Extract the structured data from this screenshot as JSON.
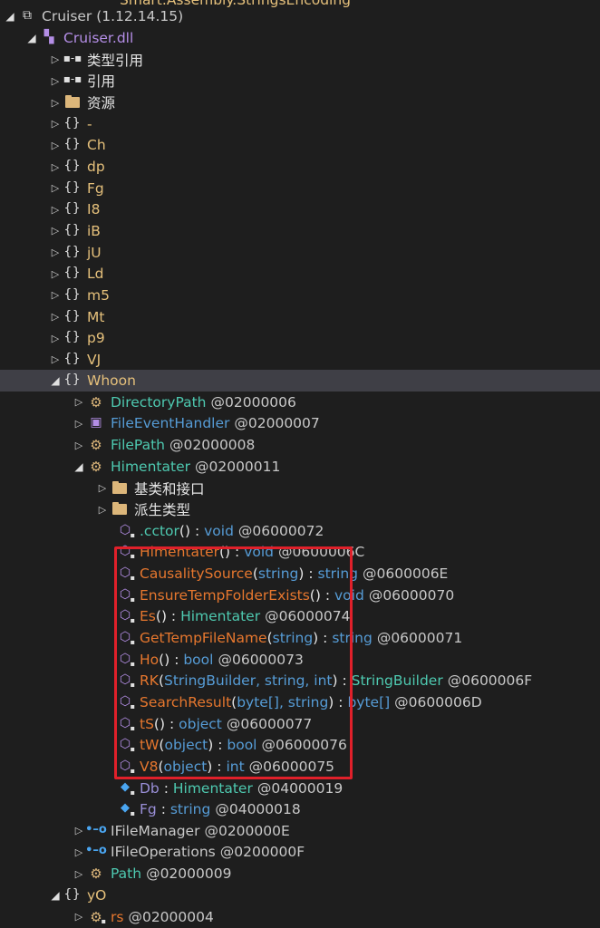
{
  "top_clip": "Smart.Assembly.StringsEncoding",
  "assembly": {
    "name": "Cruiser (1.12.14.15)"
  },
  "module": {
    "name": "Cruiser.dll"
  },
  "children": [
    {
      "label": "类型引用",
      "icon": "type-reference-icon"
    },
    {
      "label": "引用",
      "icon": "reference-icon"
    },
    {
      "label": "资源",
      "icon": "folder-icon"
    },
    {
      "label": "-",
      "icon": "namespace-icon"
    },
    {
      "label": "Ch",
      "icon": "namespace-icon"
    },
    {
      "label": "dp",
      "icon": "namespace-icon"
    },
    {
      "label": "Fg",
      "icon": "namespace-icon"
    },
    {
      "label": "I8",
      "icon": "namespace-icon"
    },
    {
      "label": "iB",
      "icon": "namespace-icon"
    },
    {
      "label": "jU",
      "icon": "namespace-icon"
    },
    {
      "label": "Ld",
      "icon": "namespace-icon"
    },
    {
      "label": "m5",
      "icon": "namespace-icon"
    },
    {
      "label": "Mt",
      "icon": "namespace-icon"
    },
    {
      "label": "p9",
      "icon": "namespace-icon"
    },
    {
      "label": "VJ",
      "icon": "namespace-icon"
    }
  ],
  "whoon": {
    "label": "Whoon",
    "types": [
      {
        "name": "DirectoryPath",
        "token": "@02000006"
      },
      {
        "name": "FileEventHandler",
        "token": "@02000007"
      },
      {
        "name": "FilePath",
        "token": "@02000008"
      }
    ],
    "himentater": {
      "name": "Himentater",
      "token": "@02000011",
      "folders": [
        "基类和接口",
        "派生类型"
      ],
      "members": [
        {
          "name": ".cctor",
          "paren_open": "(",
          "args": "",
          "paren_close": ")",
          "sep": " : ",
          "ret": "void",
          "token": "@06000072"
        },
        {
          "name": "Himentater",
          "paren_open": "(",
          "args": "",
          "paren_close": ")",
          "sep": " : ",
          "ret": "void",
          "token": "@0600006C"
        },
        {
          "name": "CausalitySource",
          "paren_open": "(",
          "args": "string",
          "paren_close": ")",
          "sep": " : ",
          "ret": "string",
          "token": "@0600006E"
        },
        {
          "name": "EnsureTempFolderExists",
          "paren_open": "(",
          "args": "",
          "paren_close": ")",
          "sep": " : ",
          "ret": "void",
          "token": "@06000070"
        },
        {
          "name": "Es",
          "paren_open": "(",
          "args": "",
          "paren_close": ")",
          "sep": " : ",
          "ret": "Himentater",
          "token": "@06000074"
        },
        {
          "name": "GetTempFileName",
          "paren_open": "(",
          "args": "string",
          "paren_close": ")",
          "sep": " : ",
          "ret": "string",
          "token": "@06000071"
        },
        {
          "name": "Ho",
          "paren_open": "(",
          "args": "",
          "paren_close": ")",
          "sep": " : ",
          "ret": "bool",
          "token": "@06000073"
        },
        {
          "name": "RK",
          "paren_open": "(",
          "args": "StringBuilder, string, int",
          "paren_close": ")",
          "sep": " : ",
          "ret": "StringBuilder",
          "token": "@0600006F"
        },
        {
          "name": "SearchResult",
          "paren_open": "(",
          "args": "byte[], string",
          "paren_close": ")",
          "sep": " : ",
          "ret": "byte[]",
          "token": "@0600006D"
        },
        {
          "name": "tS",
          "paren_open": "(",
          "args": "",
          "paren_close": ")",
          "sep": " : ",
          "ret": "object",
          "token": "@06000077"
        },
        {
          "name": "tW",
          "paren_open": "(",
          "args": "object",
          "paren_close": ")",
          "sep": " : ",
          "ret": "bool",
          "token": "@06000076"
        },
        {
          "name": "V8",
          "paren_open": "(",
          "args": "object",
          "paren_close": ")",
          "sep": " : ",
          "ret": "int",
          "token": "@06000075"
        }
      ],
      "fields": [
        {
          "name": "Db",
          "sep": " : ",
          "type": "Himentater",
          "token": "@04000019"
        },
        {
          "name": "Fg",
          "sep": " : ",
          "type": "string",
          "token": "@04000018"
        }
      ]
    },
    "more_types": [
      {
        "name": "IFileManager",
        "token": "@0200000E"
      },
      {
        "name": "IFileOperations",
        "token": "@0200000F"
      },
      {
        "name": "Path",
        "token": "@02000009"
      }
    ]
  },
  "yO": {
    "label": "yO",
    "types": [
      {
        "name": "rs",
        "token": "@02000004"
      }
    ]
  },
  "colors": {
    "background": "#1e1e1e",
    "selection": "#3f3f46",
    "namespace": "#e5c07b",
    "type_name": "#4ec9b0",
    "member_name": "#e6772e",
    "keyword": "#569cd6",
    "highlight_box": "#e0202a"
  }
}
